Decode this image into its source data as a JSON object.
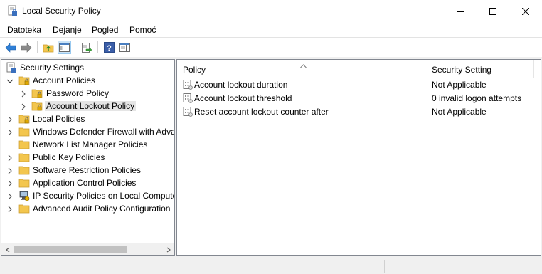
{
  "window": {
    "title": "Local Security Policy"
  },
  "menu": {
    "items": [
      "Datoteka",
      "Dejanje",
      "Pogled",
      "Pomoć"
    ]
  },
  "toolbar": {
    "buttons": [
      "back-icon",
      "forward-icon",
      "up-folder-icon",
      "show-hide-tree-icon",
      "export-list-icon",
      "help-icon",
      "properties-pane-icon"
    ]
  },
  "tree": {
    "root": "Security Settings",
    "items": [
      {
        "label": "Account Policies"
      },
      {
        "label": "Password Policy"
      },
      {
        "label": "Account Lockout Policy"
      },
      {
        "label": "Local Policies"
      },
      {
        "label": "Windows Defender Firewall with Adva"
      },
      {
        "label": "Network List Manager Policies"
      },
      {
        "label": "Public Key Policies"
      },
      {
        "label": "Software Restriction Policies"
      },
      {
        "label": "Application Control Policies"
      },
      {
        "label": "IP Security Policies on Local Compute"
      },
      {
        "label": "Advanced Audit Policy Configuration"
      }
    ]
  },
  "list": {
    "columns": [
      "Policy",
      "Security Setting"
    ],
    "rows": [
      {
        "policy": "Account lockout duration",
        "setting": "Not Applicable"
      },
      {
        "policy": "Account lockout threshold",
        "setting": "0 invalid logon attempts"
      },
      {
        "policy": "Reset account lockout counter after",
        "setting": "Not Applicable"
      }
    ]
  },
  "colors": {
    "selection": "#e5e5e5",
    "folder": "#f3c64e",
    "back_arrow": "#2f7fd6"
  }
}
